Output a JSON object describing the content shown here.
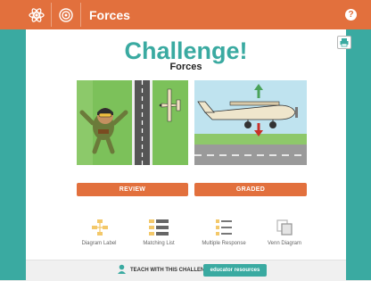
{
  "topbar": {
    "title": "Forces",
    "help_icon": "?",
    "icons": [
      "atom-icon",
      "target-icon"
    ]
  },
  "main": {
    "heading": "Challenge!",
    "subheading": "Forces",
    "buttons": {
      "review": "REVIEW",
      "graded": "GRADED"
    },
    "activities": [
      {
        "label": "Diagram Label",
        "icon": "diagram-label-icon"
      },
      {
        "label": "Matching List",
        "icon": "matching-list-icon"
      },
      {
        "label": "Multiple Response",
        "icon": "multiple-response-icon"
      },
      {
        "label": "Venn Diagram",
        "icon": "venn-diagram-icon"
      }
    ]
  },
  "footer": {
    "teach_text": "TEACH WITH THIS CHALLENGE",
    "edu_button": "educator resources"
  },
  "colors": {
    "brand_orange": "#e2703d",
    "brand_teal": "#3aaaa1"
  }
}
